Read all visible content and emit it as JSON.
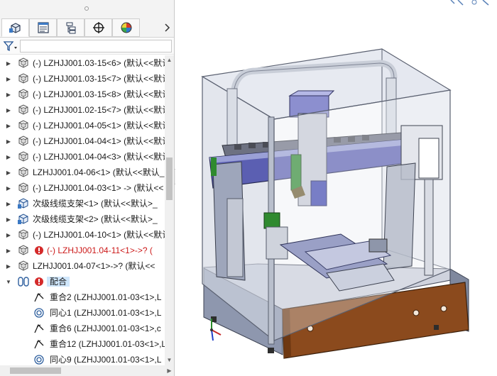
{
  "feature_tree": {
    "tabs": [
      {
        "name": "featuremanager-tab"
      },
      {
        "name": "propertymanager-tab"
      },
      {
        "name": "configurationmanager-tab"
      },
      {
        "name": "dimxpert-tab"
      },
      {
        "name": "displaymanager-tab"
      }
    ],
    "filter": {
      "value": ""
    },
    "items": [
      {
        "label": "(-) LZHJJ001.03-15<6> (默认<<默认",
        "type": "part",
        "color": "normal"
      },
      {
        "label": "(-) LZHJJ001.03-15<7> (默认<<默认",
        "type": "part",
        "color": "normal"
      },
      {
        "label": "(-) LZHJJ001.03-15<8> (默认<<默认",
        "type": "part",
        "color": "normal"
      },
      {
        "label": "(-) LZHJJ001.02-15<7> (默认<<默认",
        "type": "part",
        "color": "normal"
      },
      {
        "label": "(-) LZHJJ001.04-05<1> (默认<<默认",
        "type": "part",
        "color": "normal"
      },
      {
        "label": "(-) LZHJJ001.04-04<1> (默认<<默认",
        "type": "part",
        "color": "normal"
      },
      {
        "label": "(-) LZHJJ001.04-04<3> (默认<<默认",
        "type": "part",
        "color": "normal"
      },
      {
        "label": "LZHJJ001.04-06<1> (默认<<默认_",
        "type": "part",
        "color": "normal"
      },
      {
        "label": "(-) LZHJJ001.04-03<1> -> (默认<<",
        "type": "part",
        "color": "normal"
      },
      {
        "label": "次级线缆支架<1> (默认<<默认>_",
        "type": "assembly",
        "color": "normal"
      },
      {
        "label": "次级线缆支架<2> (默认<<默认>_",
        "type": "assembly",
        "color": "normal"
      },
      {
        "label": "(-) LZHJJ001.04-10<1> (默认<<默认",
        "type": "part",
        "color": "normal"
      },
      {
        "label": "(-) LZHJJ001.04-11<1>->? (",
        "type": "part-error",
        "color": "red"
      },
      {
        "label": "LZHJJ001.04-07<1>->? (默认<<",
        "type": "part",
        "color": "normal"
      },
      {
        "label": "配合",
        "type": "mates",
        "color": "normal"
      }
    ],
    "mates": [
      {
        "label": "重合2 (LZHJJ001.01-03<1>,L",
        "type": "coincident"
      },
      {
        "label": "同心1 (LZHJJ001.01-03<1>,L",
        "type": "concentric"
      },
      {
        "label": "重合6 (LZHJJ001.01-03<1>,c",
        "type": "coincident"
      },
      {
        "label": "重合12 (LZHJJ001.01-03<1>,L",
        "type": "coincident"
      },
      {
        "label": "同心9 (LZHJJ001.01-03<1>,L",
        "type": "concentric"
      }
    ]
  },
  "viewport": {
    "model": "three-axis dispensing machine with transparent enclosure",
    "colors": {
      "frame": "#8d97ad",
      "glass": "#d8dce6",
      "wood_panel": "#8a4a1c",
      "gantry": "#5a5fb0",
      "rail_green": "#2f8a2f"
    }
  },
  "colors": {
    "selection": "#cfe6fb",
    "error_text": "#cc1a1a"
  }
}
